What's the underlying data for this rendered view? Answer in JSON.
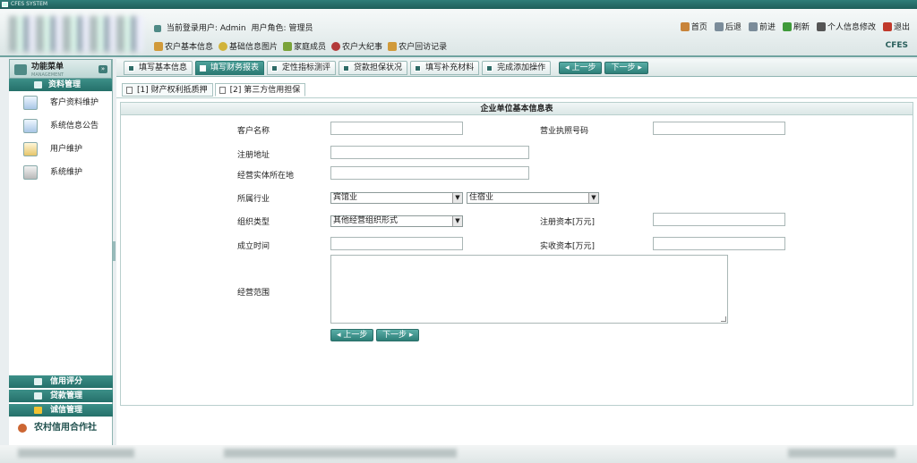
{
  "window": {
    "title": "CFES SYSTEM"
  },
  "header": {
    "user_label": "当前登录用户:",
    "user_name": "Admin",
    "role_label": "用户角色:",
    "role_name": "管理员",
    "top_links": [
      {
        "label": "首页",
        "icon": "home-icon",
        "color": "#c8843a"
      },
      {
        "label": "后退",
        "icon": "back-icon",
        "color": "#7b8c9a"
      },
      {
        "label": "前进",
        "icon": "forward-icon",
        "color": "#7b8c9a"
      },
      {
        "label": "刷新",
        "icon": "refresh-icon",
        "color": "#3f9a3a"
      },
      {
        "label": "个人信息修改",
        "icon": "edit-icon",
        "color": "#555555"
      },
      {
        "label": "退出",
        "icon": "exit-icon",
        "color": "#c0392b"
      }
    ],
    "nav_links": [
      {
        "label": "农户基本信息",
        "icon": "farmer-icon",
        "color": "#d19a3a"
      },
      {
        "label": "基础信息图片",
        "icon": "picture-icon",
        "color": "#d1b33a"
      },
      {
        "label": "家庭成员",
        "icon": "family-icon",
        "color": "#7aa33a"
      },
      {
        "label": "农户大纪事",
        "icon": "events-icon",
        "color": "#b33a3a"
      },
      {
        "label": "农户回访记录",
        "icon": "visit-icon",
        "color": "#d19a3a"
      }
    ],
    "brand": "CFES"
  },
  "sidebar": {
    "title": "功能菜单",
    "subtitle": "MANAGEMENT",
    "collapse_symbol": "»",
    "section": "资料管理",
    "items": [
      {
        "label": "客户资料维护",
        "icon": "customer-icon"
      },
      {
        "label": "系统信息公告",
        "icon": "notice-icon"
      },
      {
        "label": "用户维护",
        "icon": "user-icon"
      },
      {
        "label": "系统维护",
        "icon": "system-icon"
      }
    ],
    "bottom_sections": [
      {
        "label": "信用评分",
        "icon": "credit-icon"
      },
      {
        "label": "贷款管理",
        "icon": "loan-icon"
      },
      {
        "label": "诚信管理",
        "icon": "integrity-icon"
      }
    ],
    "footer": "农村信用合作社"
  },
  "tabs": [
    {
      "label": "填写基本信息",
      "active": false
    },
    {
      "label": "填写财务报表",
      "active": true
    },
    {
      "label": "定性指标测评",
      "active": false
    },
    {
      "label": "贷款担保状况",
      "active": false
    },
    {
      "label": "填写补充材料",
      "active": false
    },
    {
      "label": "完成添加操作",
      "active": false
    }
  ],
  "nav_buttons": {
    "prev": "◂ 上一步",
    "next": "下一步 ▸"
  },
  "subtabs": [
    {
      "label": "[1] 财产权利抵质押",
      "active": false
    },
    {
      "label": "[2] 第三方信用担保",
      "active": true
    }
  ],
  "form": {
    "title": "企业单位基本信息表",
    "fields": {
      "customer_name": {
        "label": "客户名称",
        "value": ""
      },
      "license_no": {
        "label": "营业执照号码",
        "value": ""
      },
      "reg_address": {
        "label": "注册地址",
        "value": ""
      },
      "biz_location": {
        "label": "经营实体所在地",
        "value": ""
      },
      "industry": {
        "label": "所属行业",
        "value": "宾馆业",
        "sub_value": "住宿业"
      },
      "org_type": {
        "label": "组织类型",
        "value": "其他经营组织形式"
      },
      "reg_capital": {
        "label": "注册资本[万元]",
        "value": ""
      },
      "found_date": {
        "label": "成立时间",
        "value": ""
      },
      "paid_capital": {
        "label": "实收资本[万元]",
        "value": ""
      },
      "biz_scope": {
        "label": "经营范围",
        "value": ""
      }
    },
    "prev_button": "◂ 上一步",
    "next_button": "下一步 ▸"
  }
}
